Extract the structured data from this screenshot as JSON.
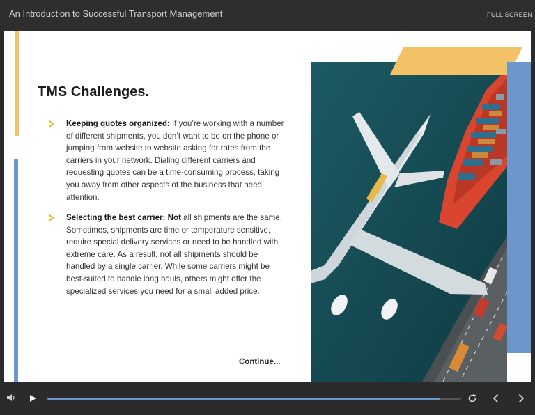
{
  "header": {
    "course_title": "An Introduction to Successful Transport Management",
    "fullscreen_label": "FULL SCREEN"
  },
  "slide": {
    "heading": "TMS Challenges.",
    "bullets": [
      {
        "bold": "Keeping quotes organized:",
        "text": " If you’re working with a number of different shipments, you don’t want to be on the phone or jumping from website to website asking for rates from the carriers in your network. Dialing different carriers and requesting quotes can be a time-consuming process, taking you away from other aspects of the business that need attention."
      },
      {
        "bold": "Selecting the best carrier: Not",
        "text": " all shipments are the same. Sometimes, shipments are time or temperature sensitive, require special delivery services or need to be handled with extreme care. As a result, not all shipments should be handled by a single carrier. While some carriers might be best-suited to handle long hauls, others might offer the specialized services you need for a small added price."
      }
    ],
    "continue_label": "Continue..."
  },
  "player": {
    "progress": 0.95
  },
  "icons": {
    "bullet": "chevron-right-icon",
    "volume": "volume-icon",
    "play": "play-icon",
    "replay": "replay-icon",
    "prev": "chevron-left-icon",
    "next": "chevron-right-icon"
  },
  "colors": {
    "accent_yellow": "#f3c266",
    "accent_blue": "#6b97cc",
    "chevron": "#f2b92b",
    "chrome": "#2b2b2b"
  }
}
